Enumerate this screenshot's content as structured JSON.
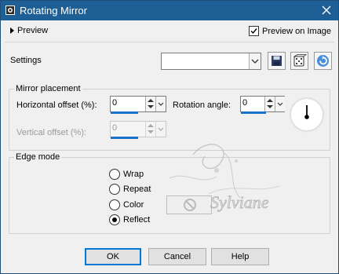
{
  "window": {
    "title": "Rotating Mirror",
    "title_bg": "#1e5f95"
  },
  "top": {
    "preview_label": "Preview",
    "preview_on_image_label": "Preview on Image",
    "preview_on_image_checked": true
  },
  "settings": {
    "label": "Settings",
    "preset_value": ""
  },
  "mirror": {
    "group_title": "Mirror placement",
    "horizontal_label": "Horizontal offset (%):",
    "horizontal_value": "0",
    "rotation_label": "Rotation angle:",
    "rotation_value": "0",
    "vertical_label": "Vertical offset (%):",
    "vertical_value": "0"
  },
  "edge": {
    "group_title": "Edge mode",
    "options": [
      {
        "label": "Wrap",
        "selected": false
      },
      {
        "label": "Repeat",
        "selected": false
      },
      {
        "label": "Color",
        "selected": false
      },
      {
        "label": "Reflect",
        "selected": true
      }
    ]
  },
  "watermark": {
    "text": "Sylviane"
  },
  "buttons": {
    "ok": "OK",
    "cancel": "Cancel",
    "help": "Help"
  },
  "colors": {
    "accent": "#1a73c8",
    "button_border_focus": "#0078d7"
  }
}
